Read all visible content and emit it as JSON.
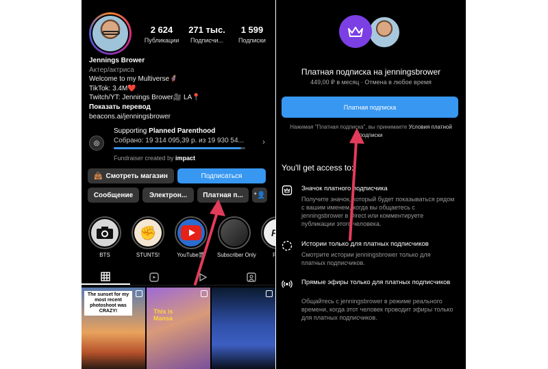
{
  "profile": {
    "stats": [
      {
        "num": "2 624",
        "label": "Публикации"
      },
      {
        "num": "271 тыс.",
        "label": "Подписчи..."
      },
      {
        "num": "1 599",
        "label": "Подписки"
      }
    ],
    "name": "Jennings Brower",
    "category": "Актер/актриса",
    "bio_line1": "Welcome to my Multiverse🦸",
    "bio_line2": "TikTok: 3.4M❤️",
    "bio_line3": "Twitch/YT: Jennings Brower🎥 LA📍",
    "translate": "Показать перевод",
    "link": "beacons.ai/jenningsbrower"
  },
  "fundraiser": {
    "title_prefix": "Supporting ",
    "title_org": "Planned Parenthood",
    "raised": "Собрано: 19 314 095,39 р. из 19 930 54...",
    "progress": 0.97,
    "by_prefix": "Fundraiser created by ",
    "by_name": "impact"
  },
  "buttons": {
    "shop": "Смотреть магазин",
    "subscribe": "Подписаться",
    "message": "Сообщение",
    "email": "Электрон...",
    "paid": "Платная п..."
  },
  "highlights": [
    {
      "label": "BTS",
      "bg": "#d8d8d8",
      "text": ""
    },
    {
      "label": "STUNTS!",
      "bg": "#f4e7d3",
      "text": "Stunts!"
    },
    {
      "label": "YouTube🎬",
      "bg": "#2a6ccf",
      "text": ""
    },
    {
      "label": "Subscriber Only",
      "bg": "#3a3a3a",
      "text": ""
    },
    {
      "label": "Fan",
      "bg": "#eeeeee",
      "text": "FA"
    }
  ],
  "grid": {
    "post1_caption": "The sunset for my most recent photoshoot was CRAZY!",
    "post2_caption": "This is Mansa"
  },
  "subscription": {
    "title": "Платная подписка на jenningsbrower",
    "subtitle": "449,00 ₽ в месяц · Отмена в любое время",
    "button": "Платная подписка",
    "terms_prefix": "Нажимая \"Платная подписка\", вы принимаете ",
    "terms_link": "Условия платной подписки",
    "access_title": "You'll get access to:",
    "features": [
      {
        "title": "Значок платного подписчика",
        "desc": "Получите значок, который будет показываться рядом с вашим именем, когда вы общаетесь с jenningsbrower в Direct или комментируете публикации этого человека."
      },
      {
        "title": "Истории только для платных подписчиков",
        "desc": "Смотрите истории jenningsbrower только для платных подписчиков."
      },
      {
        "title": "Прямые эфиры только для платных подписчиков",
        "desc": "Общайтесь с jenningsbrower в режиме реального времени, когда этот человек проводит эфиры только для платных подписчиков."
      }
    ]
  },
  "colors": {
    "accent": "#3897f0",
    "crown_bg": "#7b3fe4",
    "arrow": "#e23c5a"
  }
}
